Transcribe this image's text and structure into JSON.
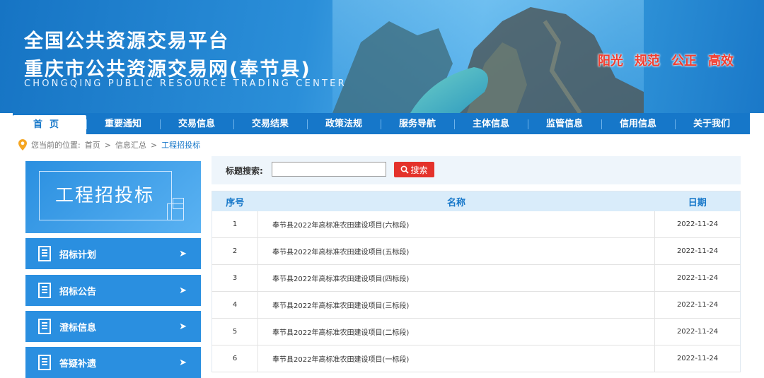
{
  "header": {
    "title_line1": "全国公共资源交易平台",
    "title_line2": "重庆市公共资源交易网(奉节县)",
    "title_en": "CHONGQING PUBLIC RESOURCE TRADING CENTER",
    "slogans": [
      "阳光",
      "规范",
      "公正",
      "高效"
    ]
  },
  "nav": {
    "items": [
      "首页",
      "重要通知",
      "交易信息",
      "交易结果",
      "政策法规",
      "服务导航",
      "主体信息",
      "监管信息",
      "信用信息",
      "关于我们"
    ],
    "active_index": 0
  },
  "breadcrumb": {
    "prefix": "您当前的位置:",
    "items": [
      "首页",
      "信息汇总",
      "工程招投标"
    ],
    "separator": ">"
  },
  "sidebar": {
    "title": "工程招投标",
    "items": [
      "招标计划",
      "招标公告",
      "澄标信息",
      "答疑补遗"
    ]
  },
  "search": {
    "label": "标题搜索:",
    "value": "",
    "placeholder": "",
    "button_label": "搜索"
  },
  "table": {
    "headers": [
      "序号",
      "名称",
      "日期"
    ],
    "rows": [
      {
        "num": "1",
        "name": "奉节县2022年高标准农田建设项目(六标段)",
        "date": "2022-11-24"
      },
      {
        "num": "2",
        "name": "奉节县2022年高标准农田建设项目(五标段)",
        "date": "2022-11-24"
      },
      {
        "num": "3",
        "name": "奉节县2022年高标准农田建设项目(四标段)",
        "date": "2022-11-24"
      },
      {
        "num": "4",
        "name": "奉节县2022年高标准农田建设项目(三标段)",
        "date": "2022-11-24"
      },
      {
        "num": "5",
        "name": "奉节县2022年高标准农田建设项目(二标段)",
        "date": "2022-11-24"
      },
      {
        "num": "6",
        "name": "奉节县2022年高标准农田建设项目(一标段)",
        "date": "2022-11-24"
      }
    ]
  },
  "colors": {
    "primary": "#1677c9",
    "sidebar": "#2a8fe0",
    "slogan": "#f23d2f",
    "search_button": "#e4322b",
    "table_header_bg": "#d9ecfa"
  }
}
